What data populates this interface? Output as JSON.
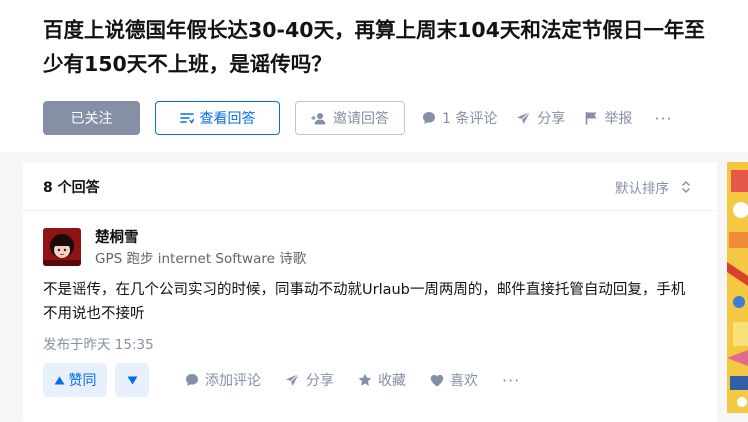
{
  "question": {
    "title": "百度上说德国年假长达30-40天，再算上周末104天和法定节假日一年至少有150天不上班，是谣传吗？"
  },
  "question_actions": {
    "followed": "已关注",
    "view_answers": "查看回答",
    "invite": "邀请回答",
    "comments": "1 条评论",
    "share": "分享",
    "report": "举报",
    "more": "···"
  },
  "answers": {
    "count": "8 个回答",
    "sort": "默认排序"
  },
  "answer": {
    "author": "楚桐雪",
    "bio": "GPS 跑步 internet Software 诗歌",
    "content": "不是谣传，在几个公司实习的时候，同事动不动就Urlaub一周两周的，邮件直接托管自动回复，手机不用说也不接听",
    "date": "发布于昨天 15:35",
    "actions": {
      "upvote": "赞同",
      "add_comment": "添加评论",
      "share": "分享",
      "collect": "收藏",
      "like": "喜欢",
      "more": "···"
    }
  },
  "colors": {
    "primary": "#056de8",
    "muted": "#8590a6",
    "followed_bg": "#8590a6",
    "vote_bg": "#e7f0fc"
  },
  "icons": [
    "list-icon",
    "add-user-icon",
    "comment-icon",
    "share-icon",
    "flag-icon",
    "sort-icon",
    "upvote-icon",
    "downvote-icon",
    "heart-icon",
    "star-icon"
  ]
}
